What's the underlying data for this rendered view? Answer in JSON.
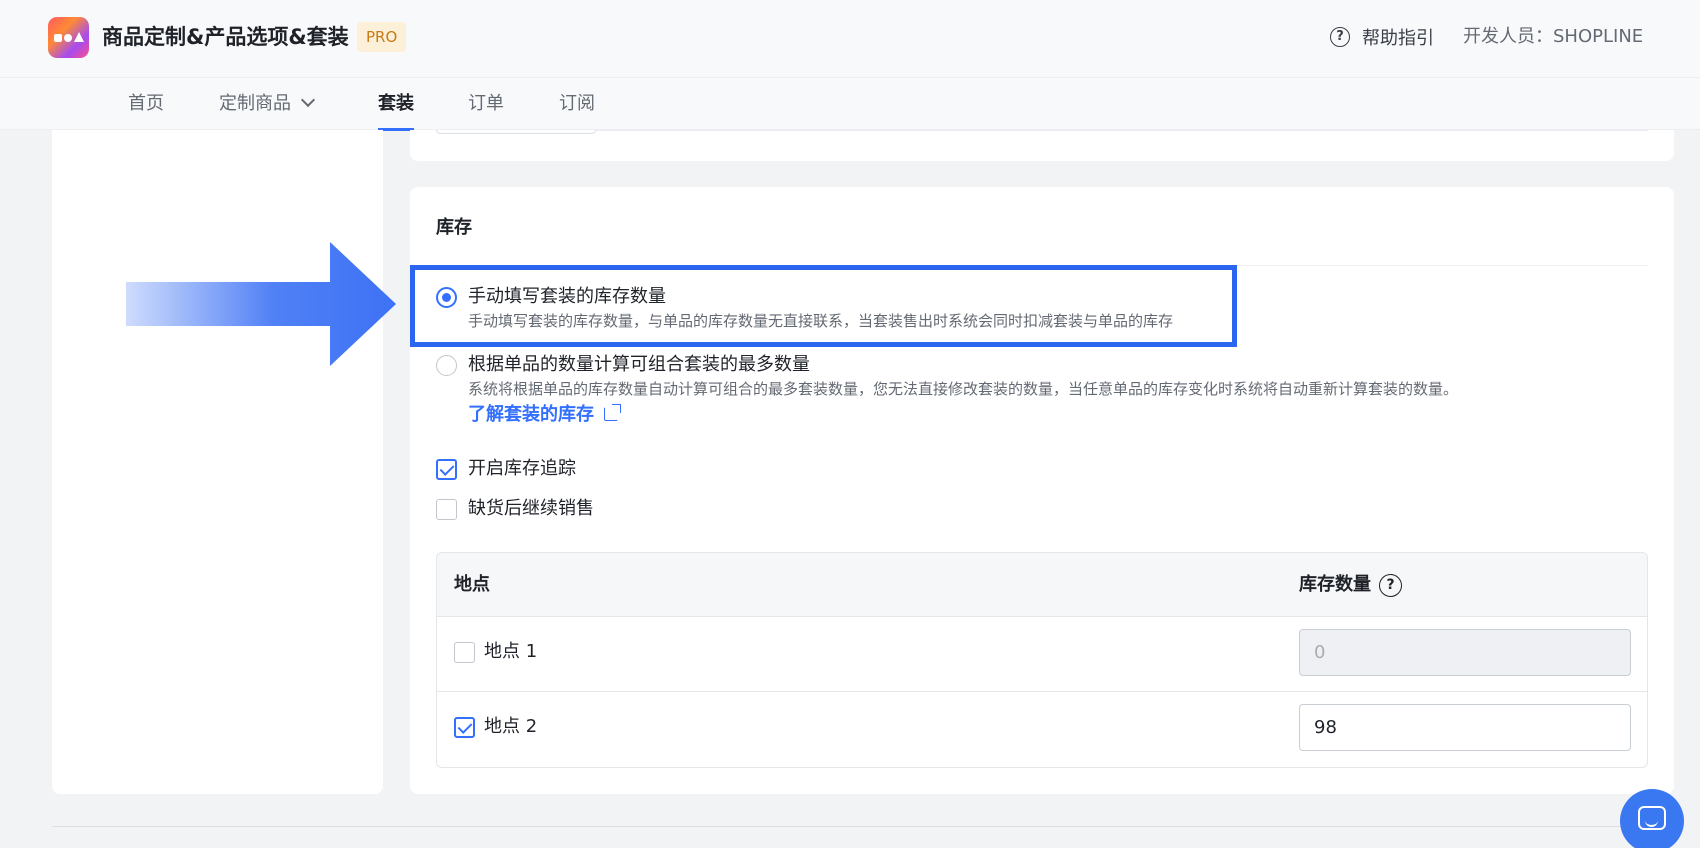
{
  "header": {
    "app_title": "商品定制&产品选项&套装",
    "badge": "PRO",
    "help_label": "帮助指引",
    "developer": "开发人员：SHOPLINE"
  },
  "nav": {
    "items": [
      {
        "label": "首页"
      },
      {
        "label": "定制商品"
      },
      {
        "label": "套装"
      },
      {
        "label": "订单"
      },
      {
        "label": "订阅"
      }
    ],
    "active": "套装"
  },
  "inventory": {
    "title": "库存",
    "options": [
      {
        "label": "手动填写套装的库存数量",
        "desc": "手动填写套装的库存数量，与单品的库存数量无直接联系，当套装售出时系统会同时扣减套装与单品的库存",
        "checked": true
      },
      {
        "label": "根据单品的数量计算可组合套装的最多数量",
        "desc": "系统将根据单品的库存数量自动计算可组合的最多套装数量，您无法直接修改套装的数量，当任意单品的库存变化时系统将自动重新计算套装的数量。",
        "link": "了解套装的库存",
        "checked": false
      }
    ],
    "checkboxes": [
      {
        "label": "开启库存追踪",
        "checked": true
      },
      {
        "label": "缺货后继续销售",
        "checked": false
      }
    ],
    "table": {
      "col_location": "地点",
      "col_quantity": "库存数量",
      "rows": [
        {
          "location": "地点 1",
          "checked": false,
          "quantity": "0",
          "disabled": true
        },
        {
          "location": "地点 2",
          "checked": true,
          "quantity": "98",
          "disabled": false
        }
      ]
    }
  },
  "colors": {
    "accent": "#3370ff",
    "highlight_border": "#2c66f0",
    "arrow": "#3d72f5"
  },
  "icons": [
    "app-logo",
    "help-circle-icon",
    "chevron-down-icon",
    "external-link-icon",
    "question-circle-icon",
    "arrow-right-icon",
    "chat-icon"
  ]
}
